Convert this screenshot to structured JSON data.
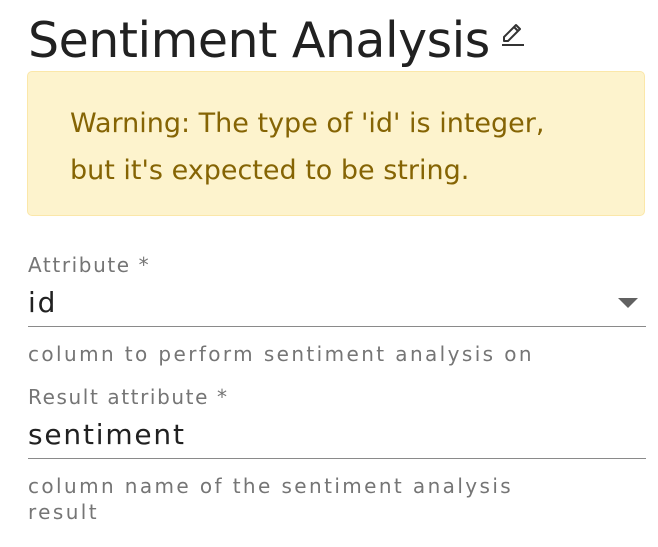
{
  "header": {
    "title": "Sentiment Analysis",
    "edit_icon": "pencil-icon"
  },
  "warning": {
    "line1": "Warning: The type of 'id' is integer,",
    "line2": "but it's expected to be string."
  },
  "fields": {
    "attribute": {
      "label": "Attribute *",
      "value": "id",
      "helper": "column to perform sentiment analysis on"
    },
    "result_attribute": {
      "label": "Result attribute *",
      "value": "sentiment",
      "helper_line1": "column name of the sentiment analysis",
      "helper_line2": "result"
    }
  },
  "colors": {
    "warning_bg": "#fdf3cd",
    "warning_text": "#856404"
  }
}
